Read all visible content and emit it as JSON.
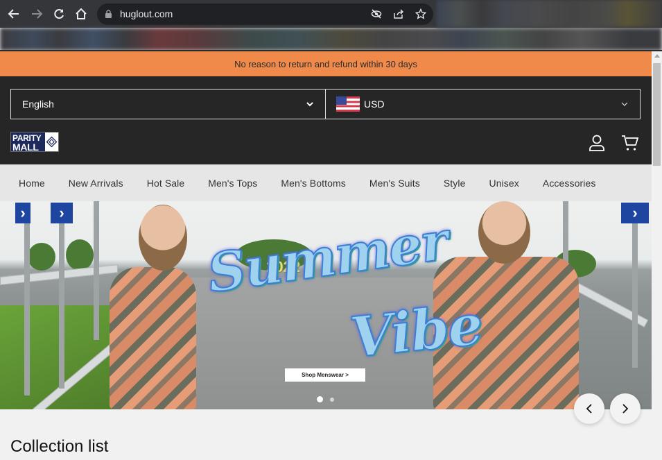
{
  "browser": {
    "url": "huglout.com",
    "back_icon": "arrow-left-icon",
    "forward_icon": "arrow-right-icon",
    "reload_icon": "reload-icon",
    "home_icon": "home-icon",
    "omnibox_icons": [
      "eye-off-icon",
      "share-icon",
      "star-icon"
    ]
  },
  "announcement": {
    "text": "No reason to return and refund within 30 days",
    "background": "#f08a4b"
  },
  "header": {
    "language": {
      "selected": "English"
    },
    "currency": {
      "selected": "USD",
      "flag": "us-flag-icon"
    },
    "logo": {
      "line1": "PARITY",
      "line2": "MALL"
    },
    "icons": [
      "account-icon",
      "cart-icon"
    ]
  },
  "menu": {
    "items": [
      {
        "label": "Home"
      },
      {
        "label": "New Arrivals"
      },
      {
        "label": "Hot Sale"
      },
      {
        "label": "Men's Tops"
      },
      {
        "label": "Men's Bottoms"
      },
      {
        "label": "Men's Suits"
      },
      {
        "label": "Style"
      },
      {
        "label": "Unisex"
      },
      {
        "label": "Accessories"
      }
    ]
  },
  "banner": {
    "year": "2022",
    "headline_1": "Summer",
    "headline_2": "Vibe",
    "cta": "Shop Menswear >",
    "slide_count": 2,
    "active_slide": 1,
    "prev_label": "‹",
    "next_label": "›"
  },
  "section": {
    "title": "Collection list"
  }
}
